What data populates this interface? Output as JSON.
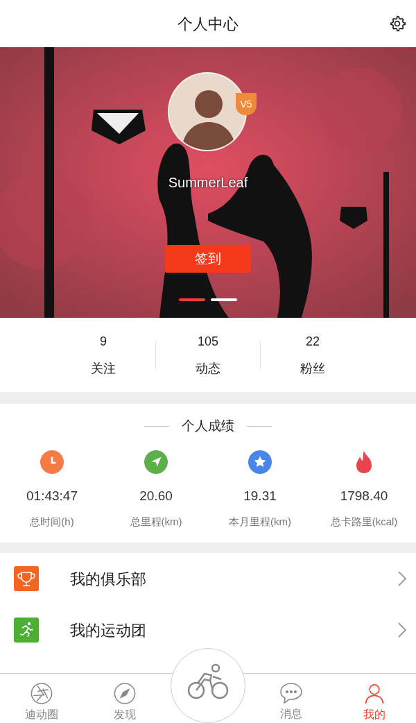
{
  "header": {
    "title": "个人中心"
  },
  "profile": {
    "username": "SummerLeaf",
    "vip_badge": "V5",
    "checkin_button": "签到",
    "pager": [
      {
        "selected": true
      },
      {
        "selected": false
      }
    ]
  },
  "stats": [
    {
      "value": "9",
      "label": "关注"
    },
    {
      "value": "105",
      "label": "动态"
    },
    {
      "value": "22",
      "label": "粉丝"
    }
  ],
  "achievements": {
    "title": "个人成绩",
    "items": [
      {
        "kind": "clock",
        "color": "#f47b45",
        "value": "01:43:47",
        "label": "总时间(h)"
      },
      {
        "kind": "arrow",
        "color": "#5cb04a",
        "value": "20.60",
        "label": "总里程(km)"
      },
      {
        "kind": "star",
        "color": "#4a86e8",
        "value": "19.31",
        "label": "本月里程(km)"
      },
      {
        "kind": "flame",
        "color": "#e8444e",
        "value": "1798.40",
        "label": "总卡路里(kcal)"
      }
    ]
  },
  "menu": [
    {
      "kind": "trophy",
      "color": "#f26522",
      "label": "我的俱乐部"
    },
    {
      "kind": "runner",
      "color": "#4caf34",
      "label": "我的运动团"
    }
  ],
  "tabbar": [
    {
      "kind": "aperture",
      "label": "迪动圈",
      "selected": false
    },
    {
      "kind": "compass",
      "label": "发现",
      "selected": false
    },
    {
      "kind": "bike",
      "selected": false
    },
    {
      "kind": "chat",
      "label": "消息",
      "selected": false
    },
    {
      "kind": "person",
      "label": "我的",
      "selected": true
    }
  ]
}
